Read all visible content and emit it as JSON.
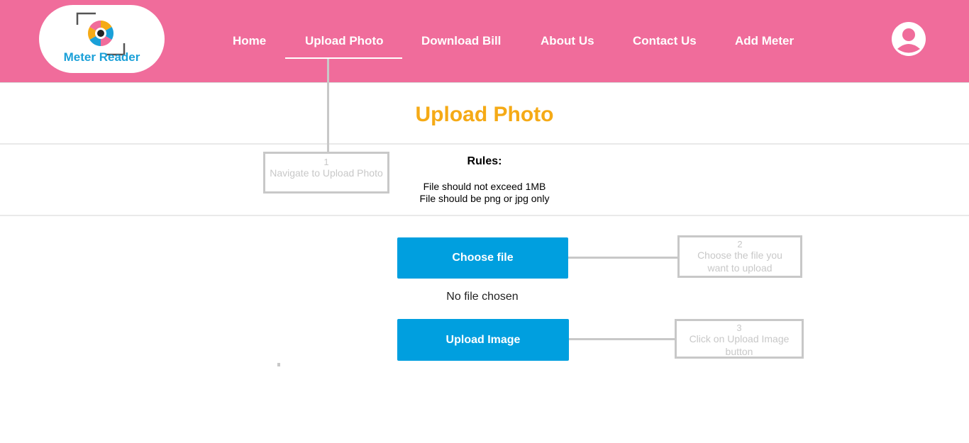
{
  "header": {
    "logo_text": "Meter Reader",
    "logo_icon": "camera-aperture-icon",
    "nav": [
      {
        "label": "Home"
      },
      {
        "label": "Upload Photo",
        "active": true
      },
      {
        "label": "Download Bill"
      },
      {
        "label": "About Us"
      },
      {
        "label": "Contact Us"
      },
      {
        "label": "Add Meter"
      }
    ],
    "profile_icon": "user-avatar-icon"
  },
  "main": {
    "title": "Upload Photo",
    "rules": {
      "heading": "Rules:",
      "items": [
        "File should not exceed 1MB",
        "File should be png or jpg only"
      ]
    },
    "choose_file_label": "Choose file",
    "file_status": "No file chosen",
    "upload_label": "Upload Image"
  },
  "callouts": [
    {
      "number": "1",
      "text": "Navigate to Upload Photo"
    },
    {
      "number": "2",
      "text": "Choose the file you want to upload"
    },
    {
      "number": "3",
      "text": "Click on Upload Image button"
    }
  ],
  "colors": {
    "header_bg": "#f06c9b",
    "title": "#f5aa16",
    "button": "#009fdf",
    "logo_text": "#1aa0d8",
    "callout": "#c8c8c8"
  }
}
